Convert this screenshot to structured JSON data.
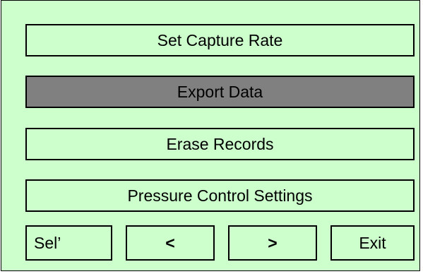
{
  "menu": {
    "items": [
      {
        "label": "Set Capture Rate",
        "selected": false
      },
      {
        "label": "Export Data",
        "selected": true
      },
      {
        "label": "Erase Records",
        "selected": false
      },
      {
        "label": "Pressure Control Settings",
        "selected": false
      }
    ]
  },
  "nav": {
    "select_label": "Sel’",
    "prev_label": "<",
    "next_label": ">",
    "exit_label": "Exit"
  },
  "colors": {
    "background": "#ccffcc",
    "selected_background": "#808080",
    "border": "#000000",
    "text": "#000000"
  }
}
